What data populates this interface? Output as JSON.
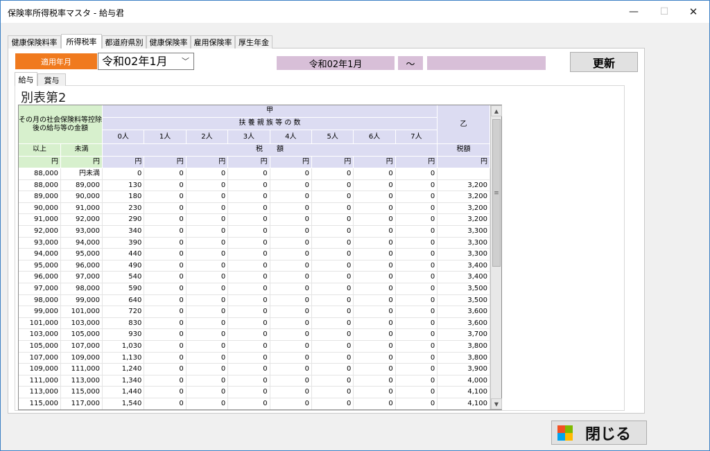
{
  "window": {
    "title": "保険率所得税率マスタ - 給与君",
    "min": "—",
    "max": "☐",
    "close": "✕"
  },
  "tabs": [
    "健康保険料率",
    "所得税率",
    "都道府県別",
    "健康保険率",
    "雇用保険率",
    "厚生年金"
  ],
  "active_tab": 1,
  "form": {
    "label_nengetsu": "適用年月",
    "select_value": "令和02年1月",
    "period_from": "令和02年1月",
    "period_sep": "～",
    "period_to": "",
    "update_button": "更新"
  },
  "subtabs": [
    "給与",
    "賞与"
  ],
  "sheet_title": "別表第2",
  "grid": {
    "header_left": "その月の社会保険料等控除後の給与等の金額",
    "kou": "甲",
    "fuyou": "扶 養 親 族 等 の 数",
    "otsu": "乙",
    "dependents": [
      "0人",
      "1人",
      "2人",
      "3人",
      "4人",
      "5人",
      "6人",
      "7人"
    ],
    "ijou": "以上",
    "miman": "未満",
    "zeigaku_kou": "税　　額",
    "zeigaku_otsu": "税額",
    "yen": "円",
    "rows": [
      [
        "88,000",
        "円未満",
        "0",
        "0",
        "0",
        "0",
        "0",
        "0",
        "0",
        "0",
        ""
      ],
      [
        "88,000",
        "89,000",
        "130",
        "0",
        "0",
        "0",
        "0",
        "0",
        "0",
        "0",
        "3,200"
      ],
      [
        "89,000",
        "90,000",
        "180",
        "0",
        "0",
        "0",
        "0",
        "0",
        "0",
        "0",
        "3,200"
      ],
      [
        "90,000",
        "91,000",
        "230",
        "0",
        "0",
        "0",
        "0",
        "0",
        "0",
        "0",
        "3,200"
      ],
      [
        "91,000",
        "92,000",
        "290",
        "0",
        "0",
        "0",
        "0",
        "0",
        "0",
        "0",
        "3,200"
      ],
      [
        "92,000",
        "93,000",
        "340",
        "0",
        "0",
        "0",
        "0",
        "0",
        "0",
        "0",
        "3,300"
      ],
      [
        "93,000",
        "94,000",
        "390",
        "0",
        "0",
        "0",
        "0",
        "0",
        "0",
        "0",
        "3,300"
      ],
      [
        "94,000",
        "95,000",
        "440",
        "0",
        "0",
        "0",
        "0",
        "0",
        "0",
        "0",
        "3,300"
      ],
      [
        "95,000",
        "96,000",
        "490",
        "0",
        "0",
        "0",
        "0",
        "0",
        "0",
        "0",
        "3,400"
      ],
      [
        "96,000",
        "97,000",
        "540",
        "0",
        "0",
        "0",
        "0",
        "0",
        "0",
        "0",
        "3,400"
      ],
      [
        "97,000",
        "98,000",
        "590",
        "0",
        "0",
        "0",
        "0",
        "0",
        "0",
        "0",
        "3,500"
      ],
      [
        "98,000",
        "99,000",
        "640",
        "0",
        "0",
        "0",
        "0",
        "0",
        "0",
        "0",
        "3,500"
      ],
      [
        "99,000",
        "101,000",
        "720",
        "0",
        "0",
        "0",
        "0",
        "0",
        "0",
        "0",
        "3,600"
      ],
      [
        "101,000",
        "103,000",
        "830",
        "0",
        "0",
        "0",
        "0",
        "0",
        "0",
        "0",
        "3,600"
      ],
      [
        "103,000",
        "105,000",
        "930",
        "0",
        "0",
        "0",
        "0",
        "0",
        "0",
        "0",
        "3,700"
      ],
      [
        "105,000",
        "107,000",
        "1,030",
        "0",
        "0",
        "0",
        "0",
        "0",
        "0",
        "0",
        "3,800"
      ],
      [
        "107,000",
        "109,000",
        "1,130",
        "0",
        "0",
        "0",
        "0",
        "0",
        "0",
        "0",
        "3,800"
      ],
      [
        "109,000",
        "111,000",
        "1,240",
        "0",
        "0",
        "0",
        "0",
        "0",
        "0",
        "0",
        "3,900"
      ],
      [
        "111,000",
        "113,000",
        "1,340",
        "0",
        "0",
        "0",
        "0",
        "0",
        "0",
        "0",
        "4,000"
      ],
      [
        "113,000",
        "115,000",
        "1,440",
        "0",
        "0",
        "0",
        "0",
        "0",
        "0",
        "0",
        "4,100"
      ],
      [
        "115,000",
        "117,000",
        "1,540",
        "0",
        "0",
        "0",
        "0",
        "0",
        "0",
        "0",
        "4,100"
      ]
    ]
  },
  "close_button": "閉じる",
  "colors": {
    "accent_orange": "#f07a1e",
    "period_bg": "#d8bfd8",
    "header_green": "#d7f0cd",
    "header_blue": "#dcdcf2"
  }
}
